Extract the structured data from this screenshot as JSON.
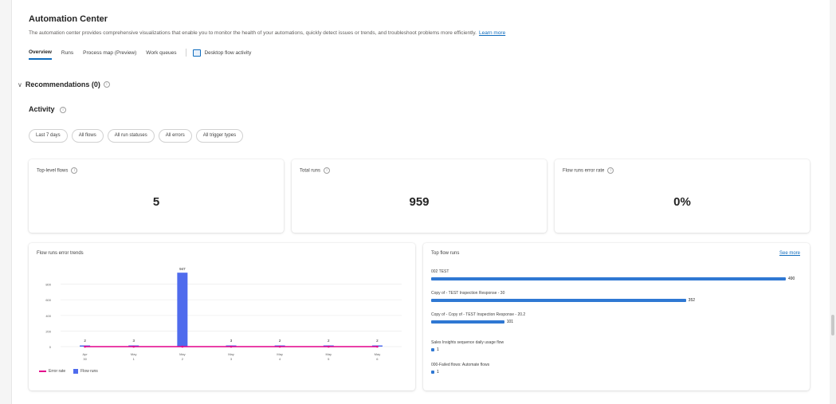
{
  "header": {
    "title": "Automation Center",
    "description": "The automation center provides comprehensive visualizations that enable you to monitor the health of your automations, quickly detect issues or trends, and troubleshoot problems more efficiently.",
    "learn_more": "Learn more"
  },
  "tabs": [
    "Overview",
    "Runs",
    "Process map (Preview)",
    "Work queues"
  ],
  "desktop_tab": "Desktop flow activity",
  "recommendations": "Recommendations (0)",
  "activity": "Activity",
  "filters": [
    "Last 7 days",
    "All flows",
    "All run statuses",
    "All errors",
    "All trigger types"
  ],
  "kpis": [
    {
      "label": "Top-level flows",
      "value": "5"
    },
    {
      "label": "Total runs",
      "value": "959"
    },
    {
      "label": "Flow runs error rate",
      "value": "0%"
    }
  ],
  "colors": {
    "accent": "#0f6cbd",
    "error_line": "#e3008c",
    "runs_bar": "#4f6bed",
    "flow_bar": "#2f78d3"
  },
  "chart_data": [
    {
      "type": "bar",
      "title": "Flow runs error trends",
      "categories": [
        [
          "Apr",
          "30"
        ],
        [
          "May",
          "1"
        ],
        [
          "May",
          "2"
        ],
        [
          "May",
          "3"
        ],
        [
          "May",
          "4"
        ],
        [
          "May",
          "5"
        ],
        [
          "May",
          "6"
        ]
      ],
      "series": [
        {
          "name": "Error rate",
          "type": "line",
          "values": [
            0,
            0,
            0,
            0,
            0,
            0,
            0
          ]
        },
        {
          "name": "Flow runs",
          "type": "bar",
          "values": [
            2,
            3,
            947,
            3,
            2,
            2,
            2
          ]
        }
      ],
      "data_labels": [
        "2",
        "3",
        "947",
        "3",
        "2",
        "2",
        "2"
      ],
      "yticks": [
        "0",
        "200",
        "400",
        "600",
        "800"
      ],
      "ylim": [
        0,
        1000
      ],
      "legend": "bottom-left"
    },
    {
      "type": "bar",
      "orientation": "horizontal",
      "title": "Top flow runs",
      "see_more": "See more",
      "categories": [
        "002 TEST",
        "Copy of - TEST Inspection Response - 30",
        "Copy of - Copy of - TEST Inspection Response - 20.2",
        "Sales Insights sequence daily usage flow",
        "000-Failed flows: Automate flows"
      ],
      "values": [
        490,
        352,
        101,
        1,
        1
      ],
      "value_labels": [
        "490",
        "352",
        "101",
        "1",
        "1"
      ]
    }
  ]
}
